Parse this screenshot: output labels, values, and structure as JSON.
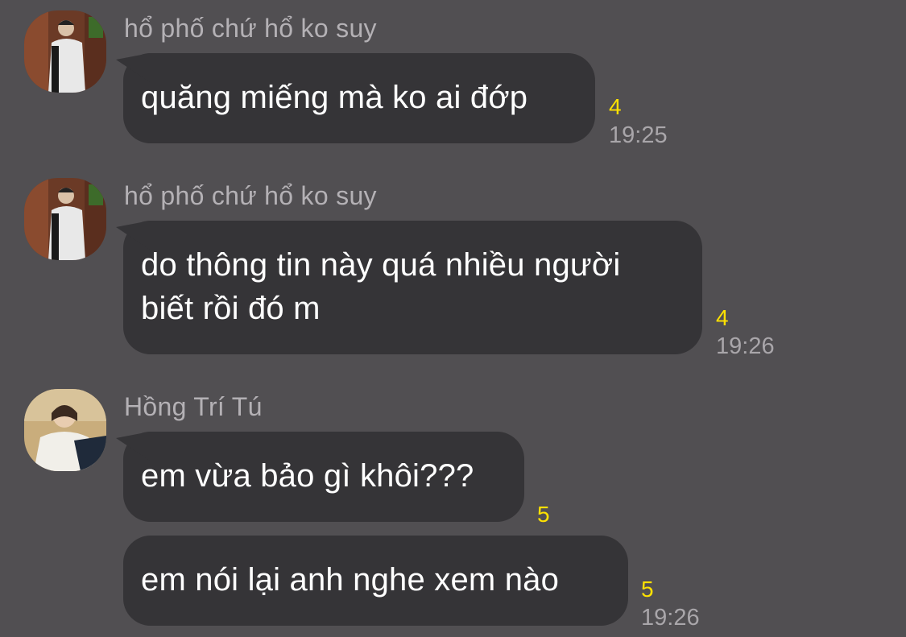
{
  "colors": {
    "background": "#514f52",
    "bubble": "#353437",
    "unread": "#ffe100",
    "sender": "#b4b1b5",
    "time": "#a9a6aa"
  },
  "messages": [
    {
      "sender": "hổ phố chứ hổ ko suy",
      "avatar": "avatar-boy-icon",
      "text": "quăng miếng mà ko ai đớp",
      "unread": "4",
      "time": "19:25"
    },
    {
      "sender": "hổ phố chứ hổ ko suy",
      "avatar": "avatar-boy-icon",
      "text": "do thông tin này quá nhiều người\nbiết rồi đó m",
      "unread": "4",
      "time": "19:26"
    },
    {
      "sender": "Hồng Trí Tú",
      "avatar": "avatar-girl-icon",
      "text": "em vừa bảo gì khôi???",
      "unread": "5",
      "time": ""
    },
    {
      "sender": "",
      "avatar": "",
      "text": "em nói lại anh nghe xem nào",
      "unread": "5",
      "time": "19:26"
    }
  ]
}
